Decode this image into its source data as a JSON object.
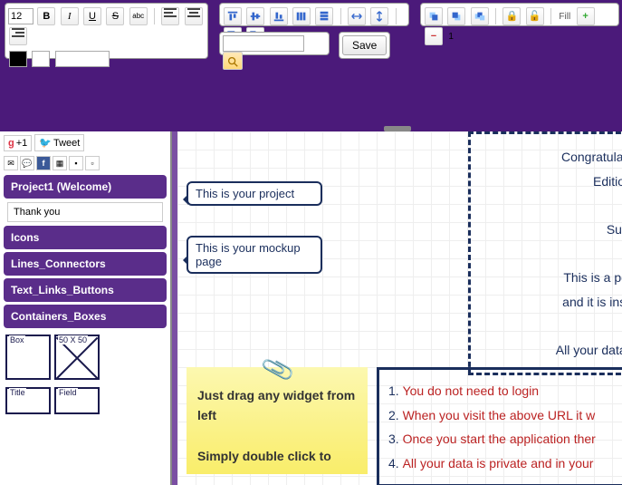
{
  "toolbar": {
    "font_size": "12",
    "bold": "B",
    "italic": "I",
    "underline": "U",
    "strike": "S",
    "abc": "abc",
    "save_label": "Save",
    "fill_label": "Fill",
    "one": "1"
  },
  "social": {
    "gplus": "+1",
    "tweet": "Tweet"
  },
  "sidebar": {
    "project_header": "Project1 (Welcome)",
    "project_item": "Thank you",
    "cats": [
      "Icons",
      "Lines_Connectors",
      "Text_Links_Buttons",
      "Containers_Boxes"
    ],
    "widgets": {
      "box": "Box",
      "fifty": "50 X 50",
      "title": "Title",
      "field": "Field"
    }
  },
  "canvas": {
    "callout1": "This is your project",
    "callout2": "This is your mockup page",
    "dashed": {
      "l1": "Congratulations! You ju",
      "l2": "Edition of M",
      "l3": "Surpris",
      "l4": "This is a personal editi",
      "l5": "and it is installed as pa",
      "l6": "All your data is stored loc"
    },
    "sticky": {
      "l1": "Just drag any widget from left",
      "l2": "Simply double click to"
    },
    "list": [
      "You do not need to login",
      "When you visit the above URL it w",
      "Once you start the application ther",
      "All your data is private and in your"
    ]
  }
}
